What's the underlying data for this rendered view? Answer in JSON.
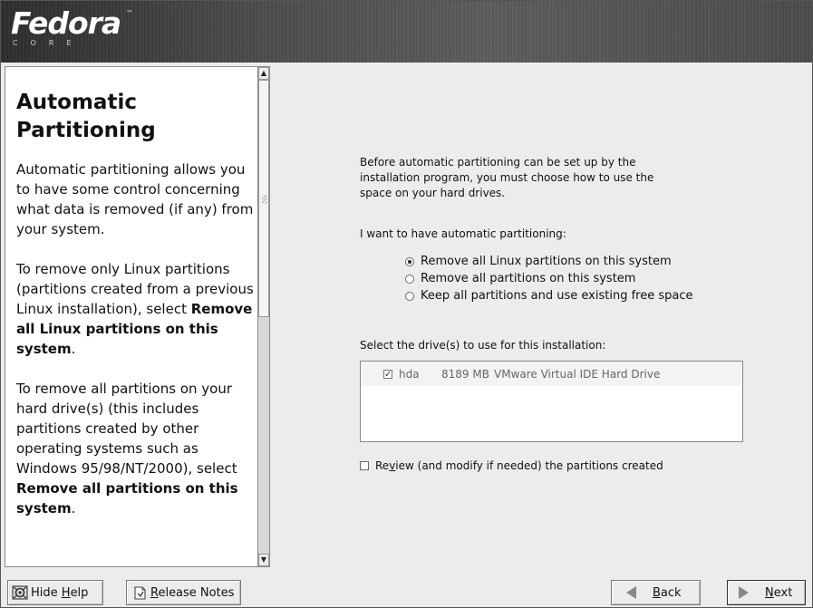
{
  "header": {
    "logo_word": "Fedora",
    "logo_tm": "™",
    "logo_sub": "CORE"
  },
  "help": {
    "title": "Automatic Partitioning",
    "para1": "Automatic partitioning allows you to have some control concerning what data is removed (if any) from your system.",
    "para2_pre": "To remove only Linux partitions (partitions created from a previous Linux installation), select ",
    "para2_bold": "Remove all Linux partitions on this system",
    "para2_post": ".",
    "para3_pre": "To remove all partitions on your hard drive(s) (this includes partitions created by other operating systems such as Windows 95/98/NT/2000), select ",
    "para3_bold": "Remove all partitions on this system",
    "para3_post": "."
  },
  "main": {
    "intro": "Before automatic partitioning can be set up by the installation program, you must choose how to use the space on your hard drives.",
    "auto_label": "I want to have automatic partitioning:",
    "options": [
      {
        "label": "Remove all Linux partitions on this system",
        "selected": true
      },
      {
        "label": "Remove all partitions on this system",
        "selected": false
      },
      {
        "label": "Keep all partitions and use existing free space",
        "selected": false
      }
    ],
    "drive_label": "Select the drive(s) to use for this installation:",
    "drives": [
      {
        "checked": true,
        "name": "hda",
        "size": "8189 MB",
        "model": "VMware Virtual IDE Hard Drive"
      }
    ],
    "review_pre": "Re",
    "review_accel": "v",
    "review_post": "iew (and modify if needed) the partitions created",
    "review_checked": false
  },
  "buttons": {
    "hide_help_pre": "Hide ",
    "hide_help_accel": "H",
    "hide_help_post": "elp",
    "release_accel": "R",
    "release_post": "elease Notes",
    "back_accel": "B",
    "back_post": "ack",
    "next_accel": "N",
    "next_post": "ext"
  }
}
